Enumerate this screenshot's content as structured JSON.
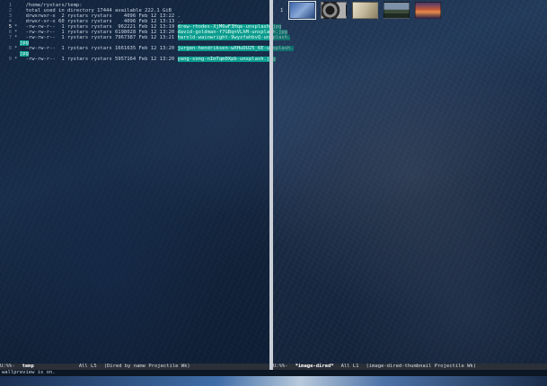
{
  "left_pane": {
    "lines": [
      {
        "n": "1",
        "mark": "",
        "text": "  /home/rystars/temp:",
        "file": ""
      },
      {
        "n": "2",
        "mark": "",
        "text": "  total used in directory 17444 available 222.1 GiB",
        "file": ""
      },
      {
        "n": "3",
        "mark": "",
        "text": "  drwxrwxr-x  2 rystars rystars    4096 Feb 12 13:22 ",
        "file": "."
      },
      {
        "n": "4",
        "mark": "",
        "text": "  drwxr-xr-x 60 rystars rystars    4096 Feb 12 13:13 ",
        "file": ".."
      },
      {
        "n": "5",
        "mark": "*",
        "text": "  -rw-rw-r--  1 rystars rystars  962221 Feb 12 13:19 ",
        "file": "drew-rhodes-XjM6wF3Hqe-unsplash.jpg"
      },
      {
        "n": "6",
        "mark": "*",
        "text": "  -rw-rw-r--  1 rystars rystars 6198028 Feb 12 13:20 ",
        "file": "david-goldman-f7GBqnVLhM-unsplash.jpg"
      },
      {
        "n": "7",
        "mark": "*",
        "text": "  -rw-rw-r--  1 rystars rystars 7967387 Feb 12 13:21 ",
        "file": "harold-wainwright-9wyzfahbvQ-unsplash."
      },
      {
        "n": "",
        "mark": "",
        "text": "",
        "file": "jpg"
      },
      {
        "n": "8",
        "mark": "*",
        "text": "  -rw-rw-r--  1 rystars rystars 1661635 Feb 12 13:20 ",
        "file": "jurgen-hendriksen-wXHuDU25_6E-unsplash."
      },
      {
        "n": "",
        "mark": "",
        "text": "",
        "file": "jpg"
      },
      {
        "n": "9",
        "mark": "*",
        "text": "  -rw-rw-r--  1 rystars rystars 5957164 Feb 12 13:20 ",
        "file": "yang-song-nImTqm0Xpb-unsplash.jpg"
      }
    ],
    "current_line": "5",
    "modeline": {
      "state": "U:%%-",
      "buffer": "temp",
      "position": "All L5",
      "mode": "(Dired by name Projectile Wk)"
    }
  },
  "right_pane": {
    "line_number": "1",
    "thumbnails": [
      {
        "name": "drew-rhodes-thumbnail",
        "class": "t1",
        "selected": true
      },
      {
        "name": "david-goldman-thumbnail",
        "class": "t2",
        "selected": false
      },
      {
        "name": "harold-wainwright-thumbnail",
        "class": "t3",
        "selected": false
      },
      {
        "name": "jurgen-hendriksen-thumbnail",
        "class": "t4",
        "selected": false
      },
      {
        "name": "yang-song-thumbnail",
        "class": "t5",
        "selected": false
      }
    ],
    "modeline": {
      "state": "U:%%-",
      "buffer": "*image-dired*",
      "position": "All L1",
      "mode": "(image-dired-thumbnail Projectile Wk)"
    }
  },
  "minibuffer": {
    "message": "wallpreview is on."
  }
}
